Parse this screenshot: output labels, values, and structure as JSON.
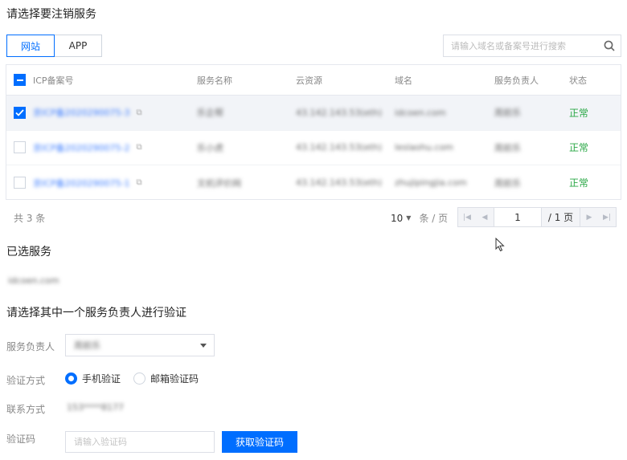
{
  "titles": {
    "select_service": "请选择要注销服务",
    "selected": "已选服务",
    "verify": "请选择其中一个服务负责人进行验证"
  },
  "tabs": [
    {
      "label": "网站",
      "active": true
    },
    {
      "label": "APP",
      "active": false
    }
  ],
  "search": {
    "placeholder": "请输入域名或备案号进行搜索"
  },
  "table": {
    "columns": [
      "ICP备案号",
      "服务名称",
      "云资源",
      "域名",
      "服务负责人",
      "状态"
    ],
    "rows": [
      {
        "selected": true,
        "icp": "京ICP备2020290075-3",
        "name": "乐企帮",
        "resource": "43.142.143.53(eth)",
        "domain": "idcoen.com",
        "owner": "周前乐",
        "status": "正常"
      },
      {
        "selected": false,
        "icp": "京ICP备2020290075-2",
        "name": "乐小虎",
        "resource": "43.142.143.53(eth)",
        "domain": "leslaohu.com",
        "owner": "周前乐",
        "status": "正常"
      },
      {
        "selected": false,
        "icp": "京ICP备2020290075-1",
        "name": "文机评价网",
        "resource": "43.142.143.53(eth)",
        "domain": "zhujipingjia.com",
        "owner": "周前乐",
        "status": "正常"
      }
    ]
  },
  "pagination": {
    "total": "共 3 条",
    "page_size": "10",
    "per_page_unit": "条 / 页",
    "current_page": "1",
    "total_pages": "/ 1 页"
  },
  "selected_service": {
    "domain": "idcoen.com"
  },
  "form": {
    "owner_label": "服务负责人",
    "owner_value": "周前乐",
    "method_label": "验证方式",
    "method_phone": "手机验证",
    "method_email": "邮箱验证码",
    "contact_label": "联系方式",
    "contact_value": "153****8177",
    "code_label": "验证码",
    "code_placeholder": "请输入验证码",
    "get_code_button": "获取验证码"
  },
  "colors": {
    "primary": "#006eff",
    "success": "#29a745"
  }
}
